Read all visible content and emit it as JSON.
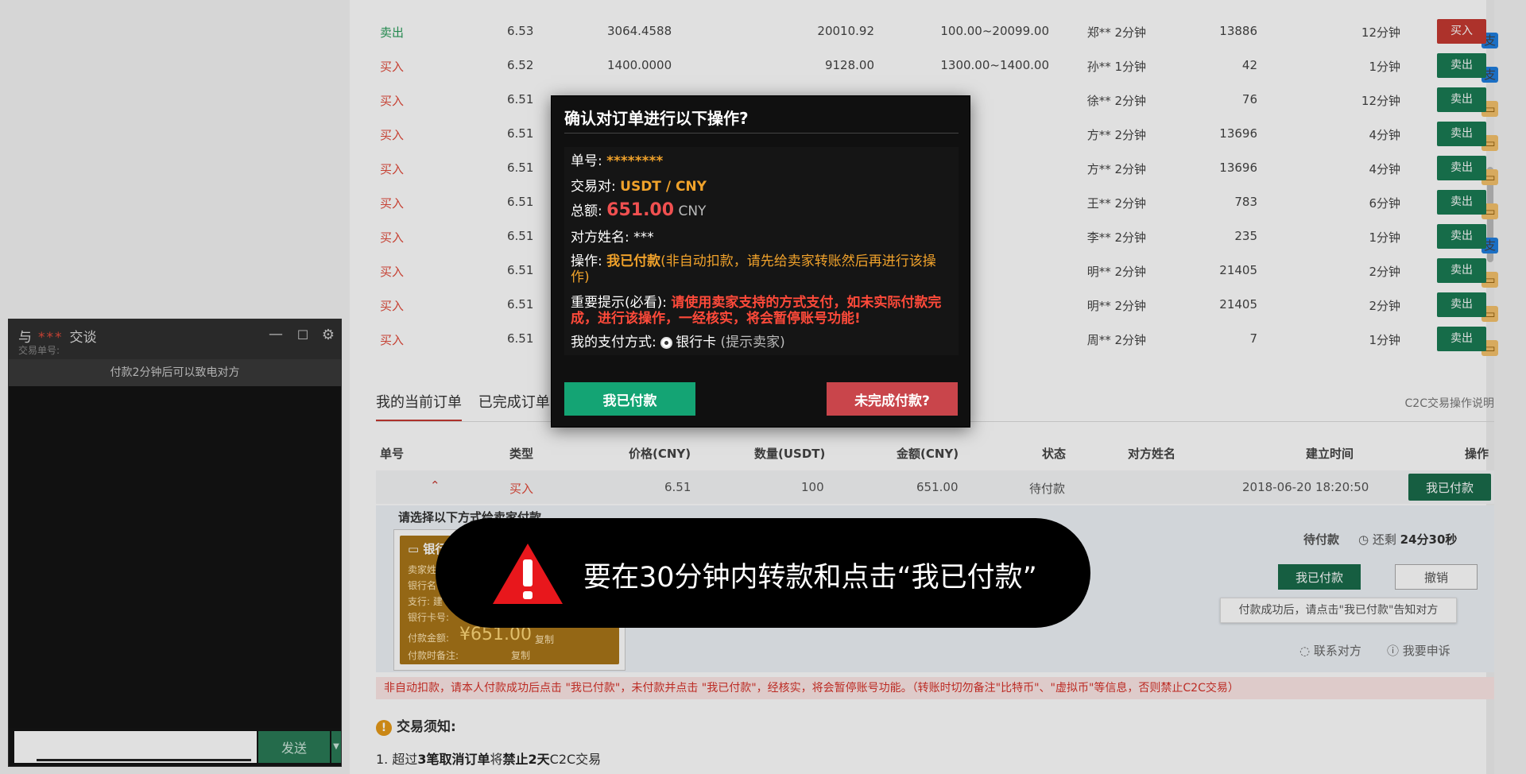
{
  "order_book": [
    {
      "type": "卖出",
      "side": "sell",
      "price": "6.53",
      "amount": "3064.4588",
      "total": "20010.92",
      "limit": "100.00~20099.00",
      "merchant": "郑** 2分钟",
      "count": "13886",
      "time": "12分钟",
      "pay": [
        "alipay"
      ],
      "action": "买入",
      "action_color": "red"
    },
    {
      "type": "买入",
      "side": "buy",
      "price": "6.52",
      "amount": "1400.0000",
      "total": "9128.00",
      "limit": "1300.00~1400.00",
      "merchant": "孙** 1分钟",
      "count": "42",
      "time": "1分钟",
      "pay": [
        "alipay"
      ],
      "action": "卖出",
      "action_color": "green"
    },
    {
      "type": "买入",
      "side": "buy",
      "price": "6.51",
      "amount": "",
      "total": "",
      "limit": "",
      "merchant": "徐** 2分钟",
      "count": "76",
      "time": "12分钟",
      "pay": [
        "bank"
      ],
      "action": "卖出",
      "action_color": "green"
    },
    {
      "type": "买入",
      "side": "buy",
      "price": "6.51",
      "amount": "",
      "total": "",
      "limit": "",
      "merchant": "方** 2分钟",
      "count": "13696",
      "time": "4分钟",
      "pay": [
        "bank"
      ],
      "action": "卖出",
      "action_color": "green"
    },
    {
      "type": "买入",
      "side": "buy",
      "price": "6.51",
      "amount": "",
      "total": "",
      "limit": "",
      "merchant": "方** 2分钟",
      "count": "13696",
      "time": "4分钟",
      "pay": [
        "bank"
      ],
      "action": "卖出",
      "action_color": "green"
    },
    {
      "type": "买入",
      "side": "buy",
      "price": "6.51",
      "amount": "",
      "total": "",
      "limit": "",
      "merchant": "王** 2分钟",
      "count": "783",
      "time": "6分钟",
      "pay": [
        "bank"
      ],
      "action": "卖出",
      "action_color": "green"
    },
    {
      "type": "买入",
      "side": "buy",
      "price": "6.51",
      "amount": "",
      "total": "",
      "limit": "",
      "merchant": "李** 2分钟",
      "count": "235",
      "time": "1分钟",
      "pay": [
        "bank",
        "alipay"
      ],
      "action": "卖出",
      "action_color": "green"
    },
    {
      "type": "买入",
      "side": "buy",
      "price": "6.51",
      "amount": "",
      "total": "",
      "limit": "",
      "merchant": "明** 2分钟",
      "count": "21405",
      "time": "2分钟",
      "pay": [
        "bank"
      ],
      "action": "卖出",
      "action_color": "green"
    },
    {
      "type": "买入",
      "side": "buy",
      "price": "6.51",
      "amount": "",
      "total": "",
      "limit": "",
      "merchant": "明** 2分钟",
      "count": "21405",
      "time": "2分钟",
      "pay": [
        "bank"
      ],
      "action": "卖出",
      "action_color": "green"
    },
    {
      "type": "买入",
      "side": "buy",
      "price": "6.51",
      "amount": "",
      "total": "",
      "limit": "",
      "merchant": "周** 2分钟",
      "count": "7",
      "time": "1分钟",
      "pay": [
        "bank"
      ],
      "action": "卖出",
      "action_color": "green"
    }
  ],
  "orders": {
    "tabs": [
      "我的当前订单",
      "已完成订单"
    ],
    "help_link": "C2C交易操作说明",
    "headers": {
      "id": "单号",
      "type": "类型",
      "price": "价格(CNY)",
      "qty": "数量(USDT)",
      "amount": "金额(CNY)",
      "status": "状态",
      "counterparty": "对方姓名",
      "created": "建立时间",
      "action": "操作"
    },
    "row": {
      "expand": "⌃",
      "type": "买入",
      "price": "6.51",
      "qty": "100",
      "amount": "651.00",
      "status": "待付款",
      "created": "2018-06-20 18:20:50",
      "action": "我已付款"
    },
    "pay_panel": {
      "choose": "请选择以下方式给卖家付款",
      "bank_title": "银行",
      "lines": [
        "卖家姓",
        "银行名",
        "支行: 建",
        "银行卡号:"
      ],
      "amount_label": "付款金额:",
      "amount": "¥651.00",
      "note_label": "付款时备注:",
      "copy": "复制",
      "status": "待付款",
      "countdown_prefix": "还剩",
      "countdown": "24分30秒",
      "paid_btn": "我已付款",
      "cancel_btn": "撤销",
      "tip": "付款成功后，请点击\"我已付款\"告知对方",
      "contact": "联系对方",
      "appeal": "我要申诉"
    },
    "warning": "非自动扣款，请本人付款成功后点击 \"我已付款\"，未付款并点击 \"我已付款\"，经核实，将会暂停账号功能。（转账时切勿备注\"比特币\"、\"虚拟币\"等信息，否则禁止C2C交易）",
    "notice_title": "交易须知:",
    "notice_1_pre": "1. 超过",
    "notice_1_b1": "3笔取消订单",
    "notice_1_mid": "将",
    "notice_1_b2": "禁止2天",
    "notice_1_post": "C2C交易"
  },
  "chat": {
    "title_pre": "与",
    "title_name": "***",
    "title_post": "交谈",
    "sub": "交易单号:",
    "note": "付款2分钟后可以致电对方",
    "send": "发送"
  },
  "modal": {
    "title": "确认对订单进行以下操作?",
    "order_no_label": "单号:",
    "order_no": "********",
    "pair_label": "交易对:",
    "pair": "USDT / CNY",
    "total_label": "总额:",
    "total": "651.00",
    "currency": "CNY",
    "name_label": "对方姓名:",
    "name": "***",
    "op_label": "操作:",
    "op": "我已付款",
    "op_note": "(非自动扣款，请先给卖家转账然后再进行该操作)",
    "important_label": "重要提示(必看):",
    "important": "请使用卖家支持的方式支付，如未实际付款完成，进行该操作，一经核实，将会暂停账号功能!",
    "method_label": "我的支付方式:",
    "method": "银行卡",
    "method_note": "(提示卖家)",
    "btn_paid": "我已付款",
    "btn_unpaid": "未完成付款?"
  },
  "toast": {
    "text": "要在30分钟内转款和点击“我已付款”"
  },
  "colors": {
    "accent_green": "#1a7b54",
    "accent_red": "#c53a32",
    "modal_bg": "#101010",
    "gold": "#f0a22b"
  }
}
